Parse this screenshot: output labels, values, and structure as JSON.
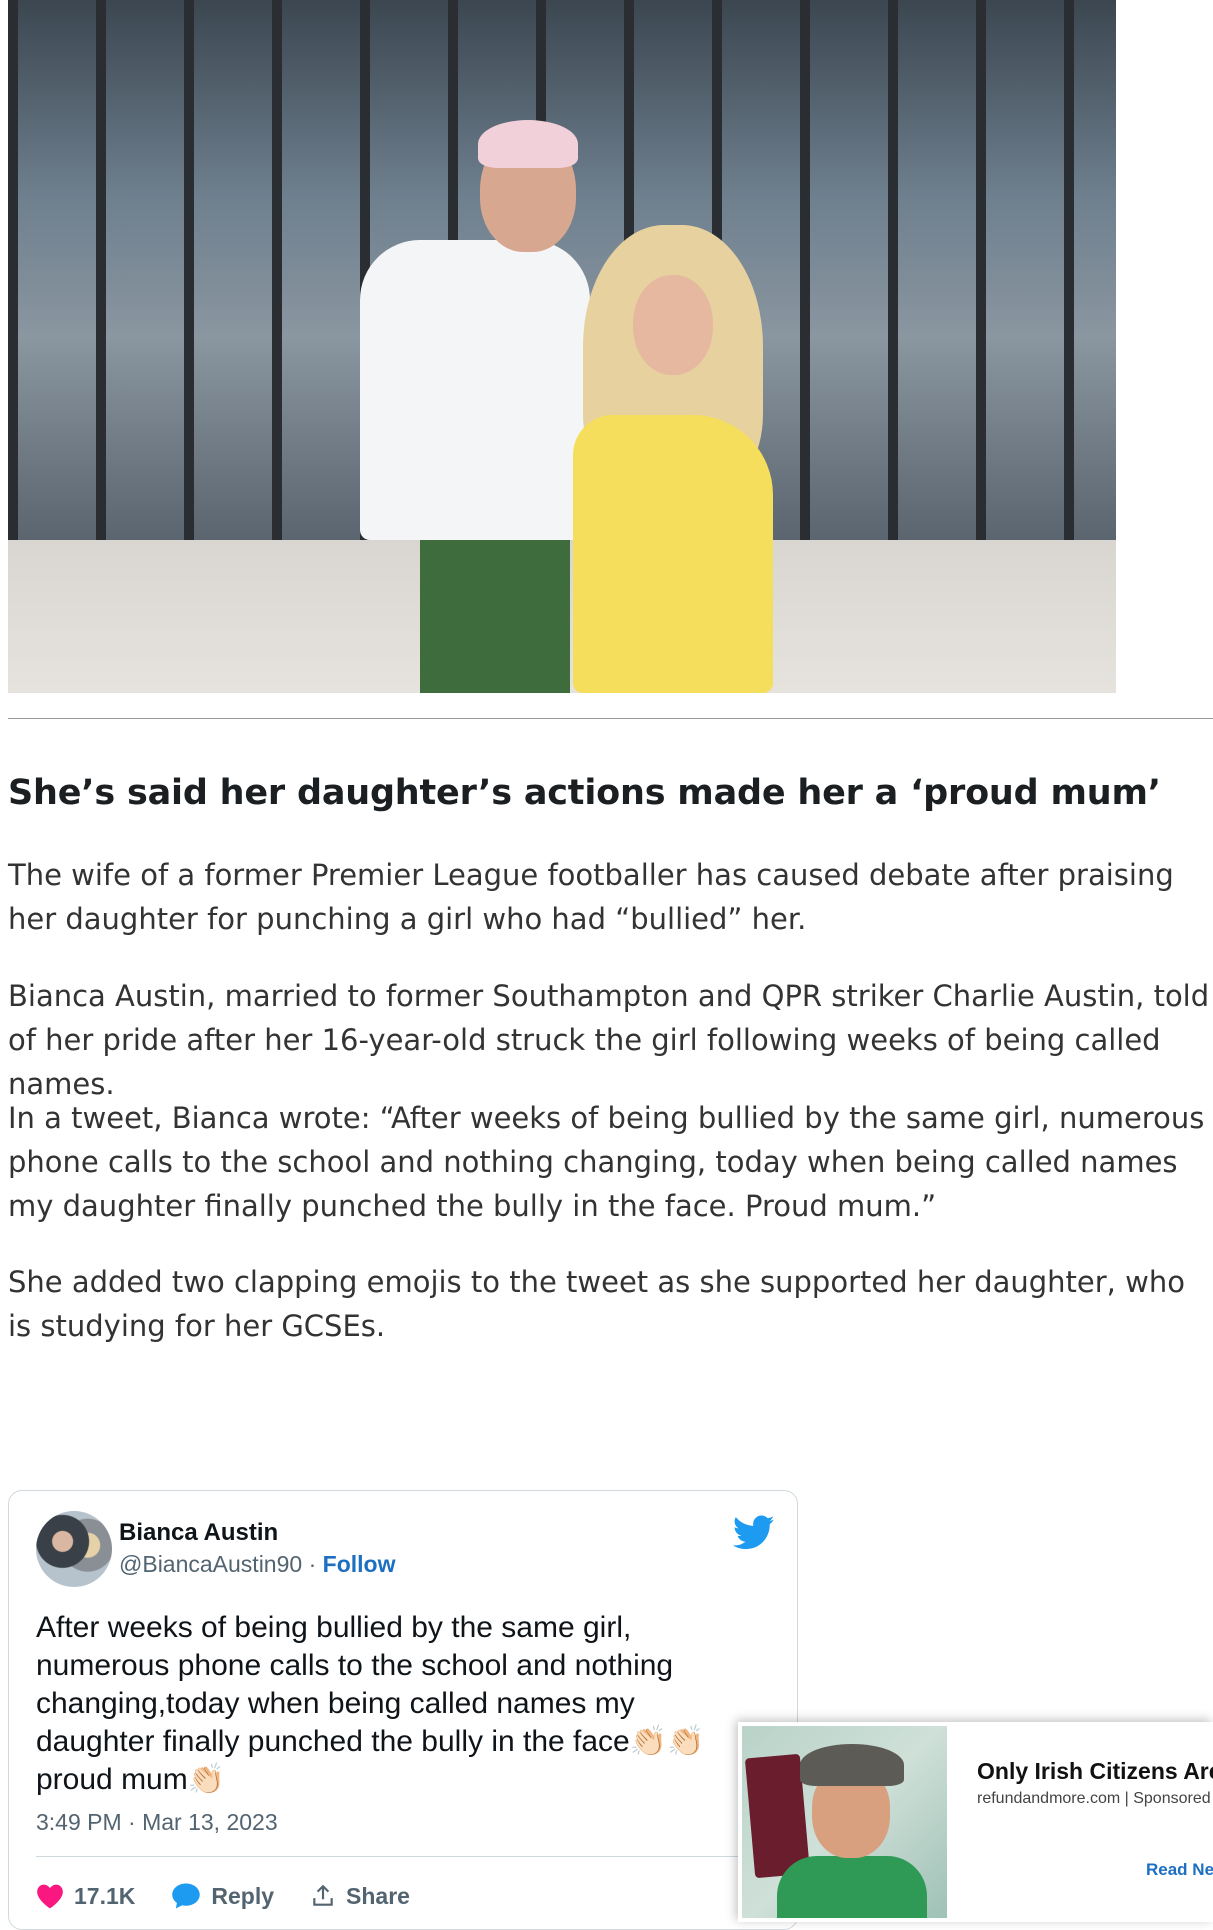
{
  "article": {
    "headline": "She’s said her daughter’s actions made her a ‘proud mum’",
    "paragraphs": [
      "The wife of a former Premier League footballer has caused debate after praising her daughter for punching a girl who had “bullied” her.",
      "Bianca Austin, married to former Southampton and QPR striker Charlie Austin, told of her pride after her 16-year-old struck the girl following weeks of being called names.",
      "In a tweet, Bianca wrote: “After weeks of being bullied by the same girl, numerous phone calls to the school and nothing changing, today when being called names my daughter finally punched the bully in the face. Proud mum.”",
      "She added two clapping emojis to the tweet as she supported her daughter, who is studying for her GCSEs."
    ]
  },
  "tweet": {
    "author_name": "Bianca Austin",
    "handle": "@BiancaAustin90",
    "separator": "·",
    "follow_label": "Follow",
    "text": "After weeks of being bullied by the same girl,\nnumerous phone calls to the school and nothing\nchanging,today when being called names my\ndaughter finally punched the bully in the face👏🏻👏🏻\nproud mum👏🏻",
    "timestamp": "3:49 PM · Mar 13, 2023",
    "likes_count": "17.1K",
    "reply_label": "Reply",
    "share_label": "Share",
    "icons": [
      "twitter-bird-icon",
      "heart-icon",
      "reply-bubble-icon",
      "share-icon"
    ],
    "colors": {
      "like": "#f91880",
      "brand": "#1d9bf0",
      "link": "#1d6fc2"
    }
  },
  "ad": {
    "title": "Only Irish Citizens Are",
    "source": "refundandmore.com | Sponsored",
    "cta": "Read Next"
  }
}
